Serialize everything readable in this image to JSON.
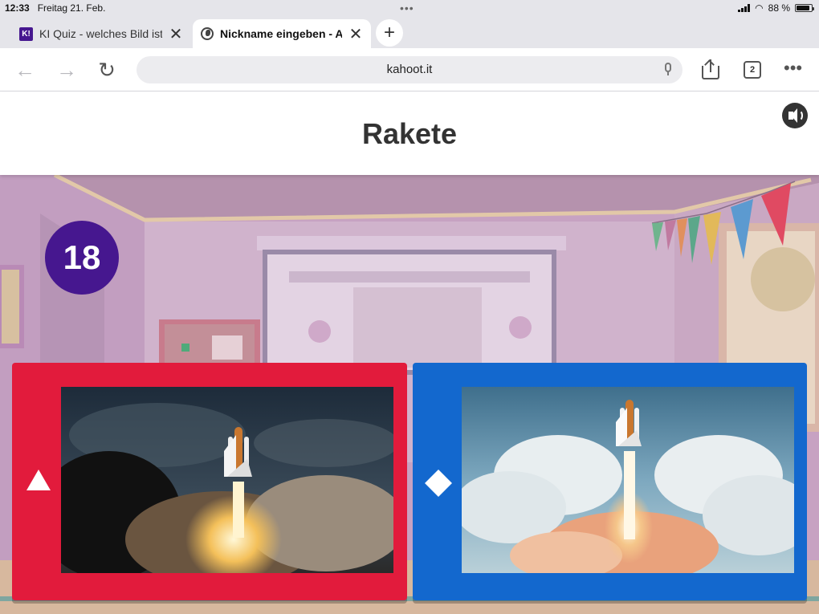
{
  "status_bar": {
    "time": "12:33",
    "date": "Freitag 21. Feb.",
    "battery": "88 %",
    "battery_level": 0.88
  },
  "tabs": [
    {
      "label": "KI Quiz - welches Bild ist",
      "favicon": "K!",
      "active": false
    },
    {
      "label": "Nickname eingeben - A",
      "favicon": "globe-icon",
      "active": true
    }
  ],
  "toolbar": {
    "url": "kahoot.it",
    "tab_count": "2"
  },
  "quiz": {
    "question_title": "Rakete",
    "timer": "18",
    "answers": [
      {
        "shape": "triangle",
        "color": "#e21b3c",
        "image": "space shuttle launch at night"
      },
      {
        "shape": "diamond",
        "color": "#1368ce",
        "image": "space shuttle launch in blue sky"
      }
    ]
  },
  "colors": {
    "kahoot_purple": "#46178f",
    "answer_red": "#e21b3c",
    "answer_blue": "#1368ce"
  }
}
